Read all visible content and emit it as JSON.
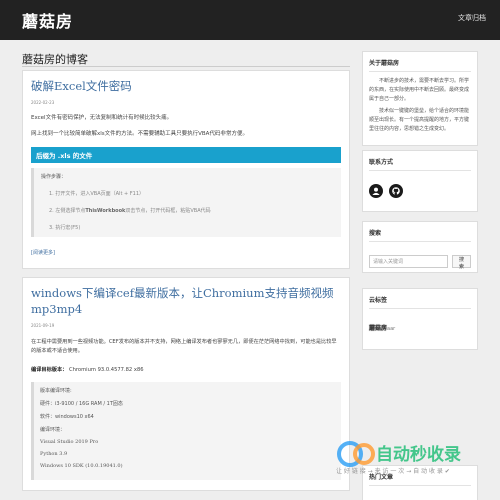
{
  "site": {
    "brand": "蘑菇房",
    "nav_link": "文章归档"
  },
  "page_heading": "蘑菇房的博客",
  "posts": [
    {
      "title": "破解Excel文件密码",
      "date": "2022-02-23",
      "p1": "Excel文件有密码保护，无法复制和统计有时候比较头痛。",
      "p2": "网上找到一个比较简单破解xls文件的方法。不需要辅助工具只要执行VBA代码非常方便。",
      "section": "后缀为 .xls 的文件",
      "steps_title": "操作步骤：",
      "step1": "1. 打开文件，进入VBA页面（Alt + F11）",
      "step2_a": "2. 左侧选择节点",
      "step2_bold": "ThisWorkbook",
      "step2_b": "双击节点，打开代码框，粘贴VBA代码",
      "step3": "3. 执行宏(F5)",
      "readmore": "[阅读更多]"
    },
    {
      "title": "windows下编译cef最新版本，让Chromium支持音频视频mp3mp4",
      "date": "2021-09-19",
      "p1": "在工程中需要用到一些视频功能。CEF发布的版本并不支持，网络上编译发布者也寥寥无几，即便在茫茫网络中找到，可能也是比较早的版本或不适合使用。",
      "target_label": "编译目标版本：",
      "target_value": "Chromium 93.0.4577.82 x86",
      "env_title": "版本编译环境:",
      "env_hw": "硬件：i3-9100 / 16G RAM / 1T固态",
      "env_sw": "软件：windows10 x64",
      "env_build": "编译环境：",
      "env_vs": "Visual Studio 2019 Pro",
      "env_py": "Python 3.9",
      "env_sdk": "Windows 10 SDK (10.0.19041.0)"
    }
  ],
  "sidebar": {
    "about": {
      "title": "关于蘑菇房",
      "p1": "不断进步的技术，需要不断去学习。所学的东西，在实际使用中不断去回顾。最终变成属于自己一部分。",
      "p2": "技术似一键键的堡垒，给个适合的环境能顺至出现长。有一个提高提醒的地方，平方键里往往的内容，思想错之生成变幻。"
    },
    "contact": {
      "title": "联系方式",
      "icon1": "user-circle-icon",
      "icon2": "github-icon"
    },
    "search": {
      "title": "搜索",
      "placeholder": "请输入关键词",
      "button": "搜索"
    },
    "tags": {
      "title": "云标签",
      "tag1": "蘑菇房",
      "tag2": "aar"
    },
    "more": {
      "title": "热门文章"
    }
  },
  "watermark": {
    "text": "自动秒收录",
    "subtext": "让 好 链 接 → 来 访 一 次 → 自 动 收 录 ✔"
  },
  "colors": {
    "navbar": "#222222",
    "accent": "#19a1cd",
    "link": "#3f6ea0",
    "background": "#eeeeee"
  }
}
